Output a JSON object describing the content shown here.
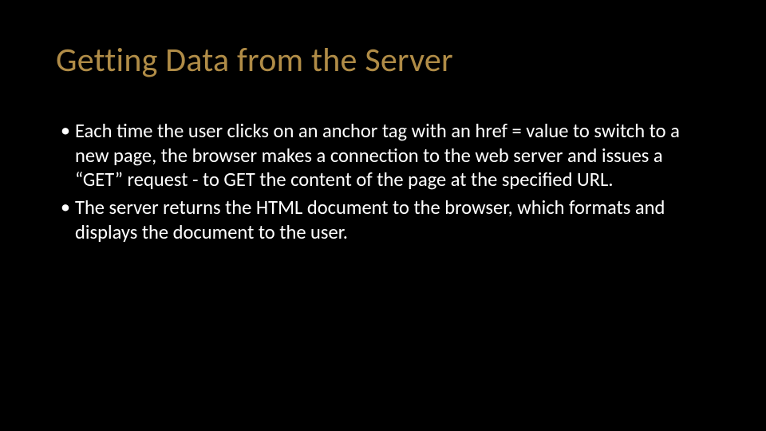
{
  "slide": {
    "title": "Getting Data from the Server",
    "bullets": [
      "Each time the user clicks on an anchor tag with an href =  value to switch to a new page, the browser makes a connection to the web server and issues a “GET” request - to GET the content of the page at the specified URL.",
      "The server returns the HTML document to the browser, which formats and displays the document to the user."
    ]
  }
}
